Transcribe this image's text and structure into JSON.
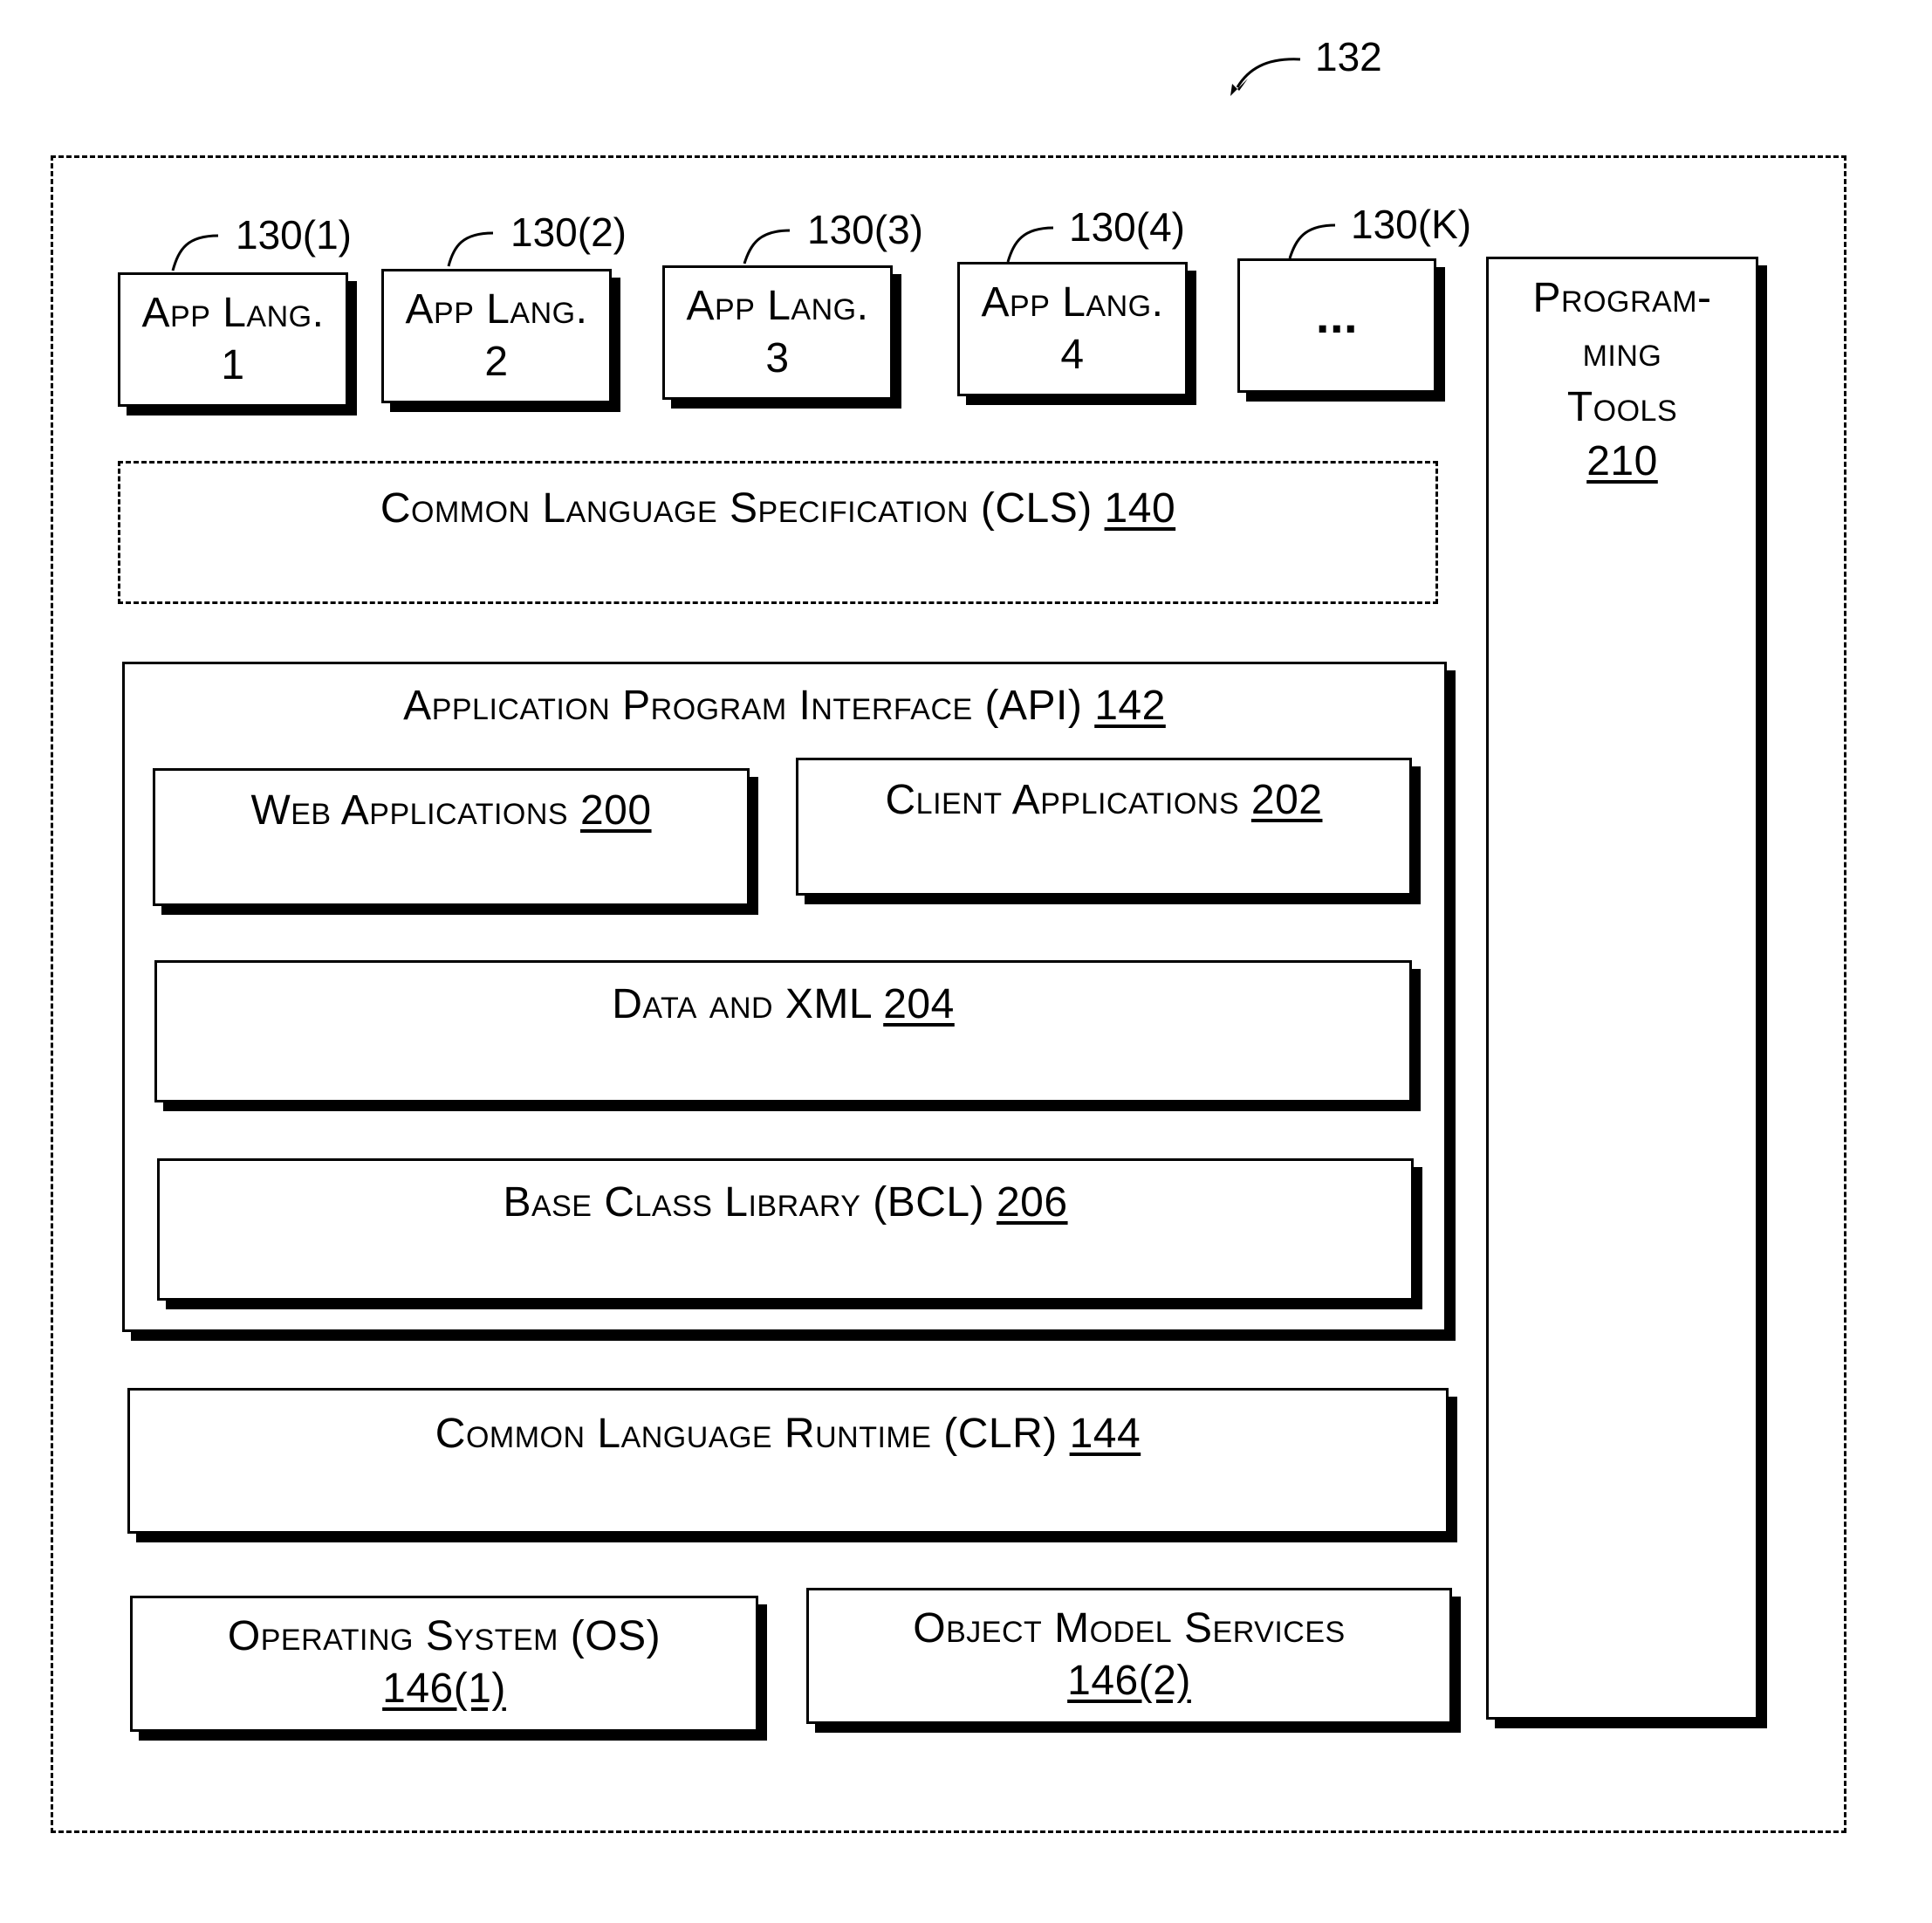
{
  "figure_ref": "132",
  "app_languages": [
    {
      "ref": "130(1)",
      "line1": "App Lang.",
      "line2": "1"
    },
    {
      "ref": "130(2)",
      "line1": "App Lang.",
      "line2": "2"
    },
    {
      "ref": "130(3)",
      "line1": "App Lang.",
      "line2": "3"
    },
    {
      "ref": "130(4)",
      "line1": "App Lang.",
      "line2": "4"
    },
    {
      "ref": "130(K)",
      "line1": "...",
      "line2": ""
    }
  ],
  "programming_tools": {
    "line1": "Program-",
    "line2": "ming",
    "line3": "Tools",
    "num": "210"
  },
  "cls": {
    "label": "Common Language Specification (CLS)",
    "num": "140"
  },
  "api": {
    "label": "Application Program Interface  (API)",
    "num": "142"
  },
  "web_apps": {
    "label": "Web Applications",
    "num": "200"
  },
  "client_apps": {
    "label": "Client Applications",
    "num": "202"
  },
  "data_xml": {
    "label": "Data and XML",
    "num": "204"
  },
  "bcl": {
    "label": "Base Class Library (BCL)",
    "num": "206"
  },
  "clr": {
    "label": "Common Language Runtime (CLR)",
    "num": "144"
  },
  "os": {
    "label": "Operating System (OS)",
    "num": "146(1)"
  },
  "oms": {
    "label": "Object Model Services",
    "num": "146(2)"
  }
}
